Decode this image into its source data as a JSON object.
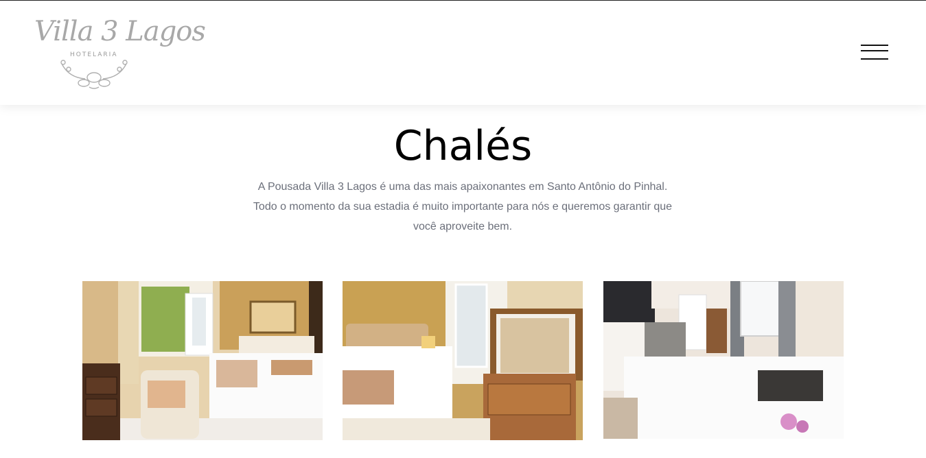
{
  "brand": {
    "name": "Villa 3 Lagos",
    "subtitle": "HOTELARIA"
  },
  "header": {
    "menu_icon": "hamburger-menu-icon"
  },
  "main": {
    "title": "Chalés",
    "intro_lines": [
      "A Pousada Villa 3 Lagos é uma das mais apaixonantes em Santo Antônio do Pinhal.",
      "Todo o momento da sua estadia é muito importante para nós e queremos garantir que",
      "você aproveite bem."
    ]
  },
  "colors": {
    "title": "#000000",
    "body_text": "#6b6f7a",
    "logo": "#a8a8a8"
  }
}
